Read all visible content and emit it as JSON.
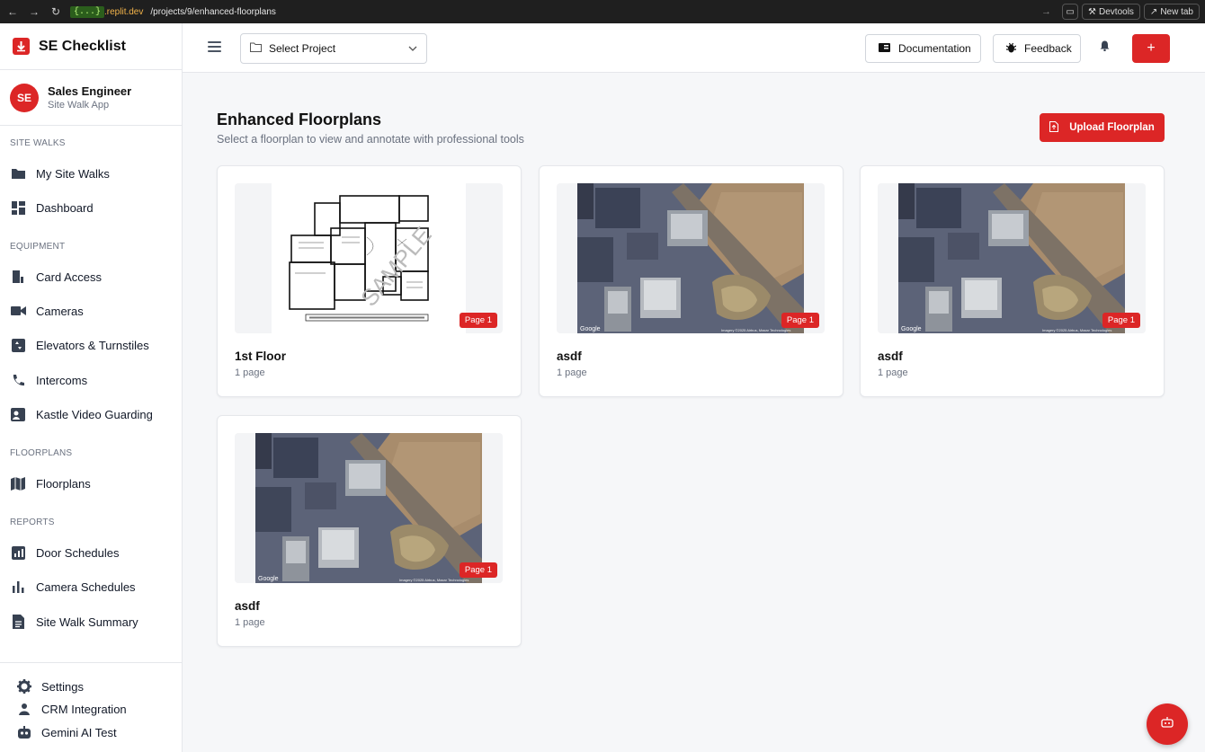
{
  "browser": {
    "host": "{...}",
    "host_suffix": ".replit.dev",
    "path": "/projects/9/enhanced-floorplans",
    "devtools": "Devtools",
    "new_tab": "New tab"
  },
  "brand": {
    "name": "SE Checklist",
    "color": "#dc2626"
  },
  "user": {
    "initials": "SE",
    "name": "Sales Engineer",
    "subtitle": "Site Walk App"
  },
  "sidebar": {
    "sections": [
      {
        "label": "Site Walks",
        "items": [
          {
            "label": "My Site Walks",
            "icon": "folder-icon"
          },
          {
            "label": "Dashboard",
            "icon": "dashboard-icon"
          }
        ]
      },
      {
        "label": "Equipment",
        "items": [
          {
            "label": "Card Access",
            "icon": "door-icon"
          },
          {
            "label": "Cameras",
            "icon": "camera-icon"
          },
          {
            "label": "Elevators & Turnstiles",
            "icon": "elevator-icon"
          },
          {
            "label": "Intercoms",
            "icon": "phone-icon"
          },
          {
            "label": "Kastle Video Guarding",
            "icon": "video-guard-icon"
          }
        ]
      },
      {
        "label": "Floorplans",
        "items": [
          {
            "label": "Floorplans",
            "icon": "map-icon"
          }
        ]
      },
      {
        "label": "Reports",
        "items": [
          {
            "label": "Door Schedules",
            "icon": "report-icon"
          },
          {
            "label": "Camera Schedules",
            "icon": "bar-chart-icon"
          },
          {
            "label": "Site Walk Summary",
            "icon": "summary-icon"
          }
        ]
      }
    ],
    "bottom": [
      {
        "label": "Settings",
        "icon": "gear-icon"
      },
      {
        "label": "CRM Integration",
        "icon": "crm-icon"
      },
      {
        "label": "Gemini AI Test",
        "icon": "robot-icon"
      }
    ]
  },
  "header": {
    "select_project": "Select Project",
    "documentation": "Documentation",
    "feedback": "Feedback",
    "add": "+"
  },
  "main": {
    "title": "Enhanced Floorplans",
    "subtitle": "Select a floorplan to view and annotate with professional tools",
    "upload": "Upload Floorplan",
    "floorplans": [
      {
        "name": "1st Floor",
        "pages": "1 page",
        "badge": "Page 1",
        "thumb": "floorplan-drawing"
      },
      {
        "name": "asdf",
        "pages": "1 page",
        "badge": "Page 1",
        "thumb": "aerial-photo"
      },
      {
        "name": "asdf",
        "pages": "1 page",
        "badge": "Page 1",
        "thumb": "aerial-photo"
      },
      {
        "name": "asdf",
        "pages": "1 page",
        "badge": "Page 1",
        "thumb": "aerial-photo"
      }
    ]
  }
}
